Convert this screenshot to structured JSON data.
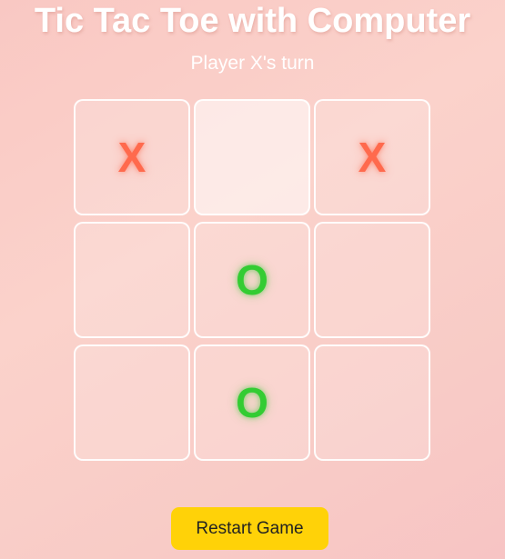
{
  "game": {
    "title": "Tic Tac Toe with Computer",
    "status": "Player X's turn",
    "board": [
      "X",
      "",
      "X",
      "",
      "O",
      "",
      "",
      "O",
      ""
    ],
    "restart_label": "Restart Game"
  },
  "colors": {
    "x_mark": "#ff6a4d",
    "o_mark": "#33cc33",
    "restart_button": "#ffd208"
  }
}
